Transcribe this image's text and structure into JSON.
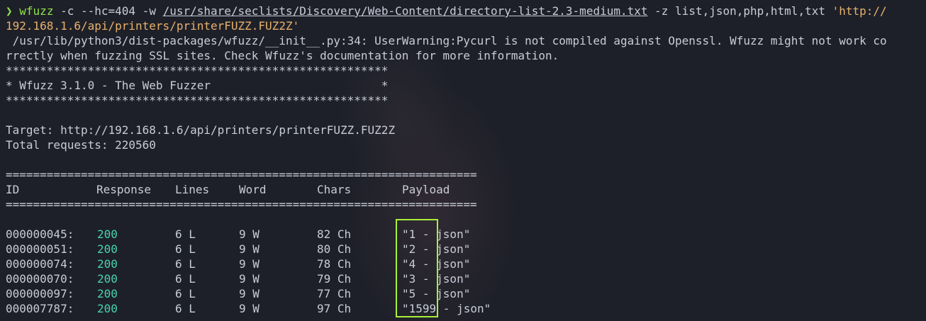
{
  "command": {
    "prompt": "❯",
    "program": "wfuzz",
    "args_before_path": " -c --hc=404 -w ",
    "wordlist": "/usr/share/seclists/Discovery/Web-Content/directory-list-2.3-medium.txt",
    "args_after_path": " -z list,json,php,html,txt ",
    "url_part1": "'http://",
    "url_part2": "192.168.1.6/api/printers/printerFUZZ.FUZ2Z'"
  },
  "warning": {
    "line1": " /usr/lib/python3/dist-packages/wfuzz/__init__.py:34: UserWarning:Pycurl is not compiled against Openssl. Wfuzz might not work co",
    "line2": "rrectly when fuzzing SSL sites. Check Wfuzz's documentation for more information."
  },
  "banner": {
    "stars": "********************************************************",
    "title": "* Wfuzz 3.1.0 - The Web Fuzzer                         *"
  },
  "target": {
    "line": "Target: http://192.168.1.6/api/printers/printerFUZZ.FUZ2Z",
    "total": "Total requests: 220560"
  },
  "table": {
    "separator": "=====================================================================",
    "headers": {
      "id": "ID",
      "response": "Response",
      "lines": "Lines",
      "word": "Word",
      "chars": "Chars",
      "payload": "Payload"
    },
    "rows": [
      {
        "id": "000000045:",
        "response": "200",
        "lines": "6 L",
        "word": "9 W",
        "chars": "82 Ch",
        "payload": "\"1 - json\""
      },
      {
        "id": "000000051:",
        "response": "200",
        "lines": "6 L",
        "word": "9 W",
        "chars": "80 Ch",
        "payload": "\"2 - json\""
      },
      {
        "id": "000000074:",
        "response": "200",
        "lines": "6 L",
        "word": "9 W",
        "chars": "78 Ch",
        "payload": "\"4 - json\""
      },
      {
        "id": "000000070:",
        "response": "200",
        "lines": "6 L",
        "word": "9 W",
        "chars": "79 Ch",
        "payload": "\"3 - json\""
      },
      {
        "id": "000000097:",
        "response": "200",
        "lines": "6 L",
        "word": "9 W",
        "chars": "77 Ch",
        "payload": "\"5 - json\""
      },
      {
        "id": "000007787:",
        "response": "200",
        "lines": "6 L",
        "word": "9 W",
        "chars": "97 Ch",
        "payload": "\"1599 - json\""
      }
    ]
  },
  "colors": {
    "background": "#1e2029",
    "prompt_green": "#8fe34a",
    "string_orange": "#e8b16a",
    "status_teal": "#47d3b0",
    "highlight_box": "#a7f03a",
    "text": "#c8ccd8"
  }
}
